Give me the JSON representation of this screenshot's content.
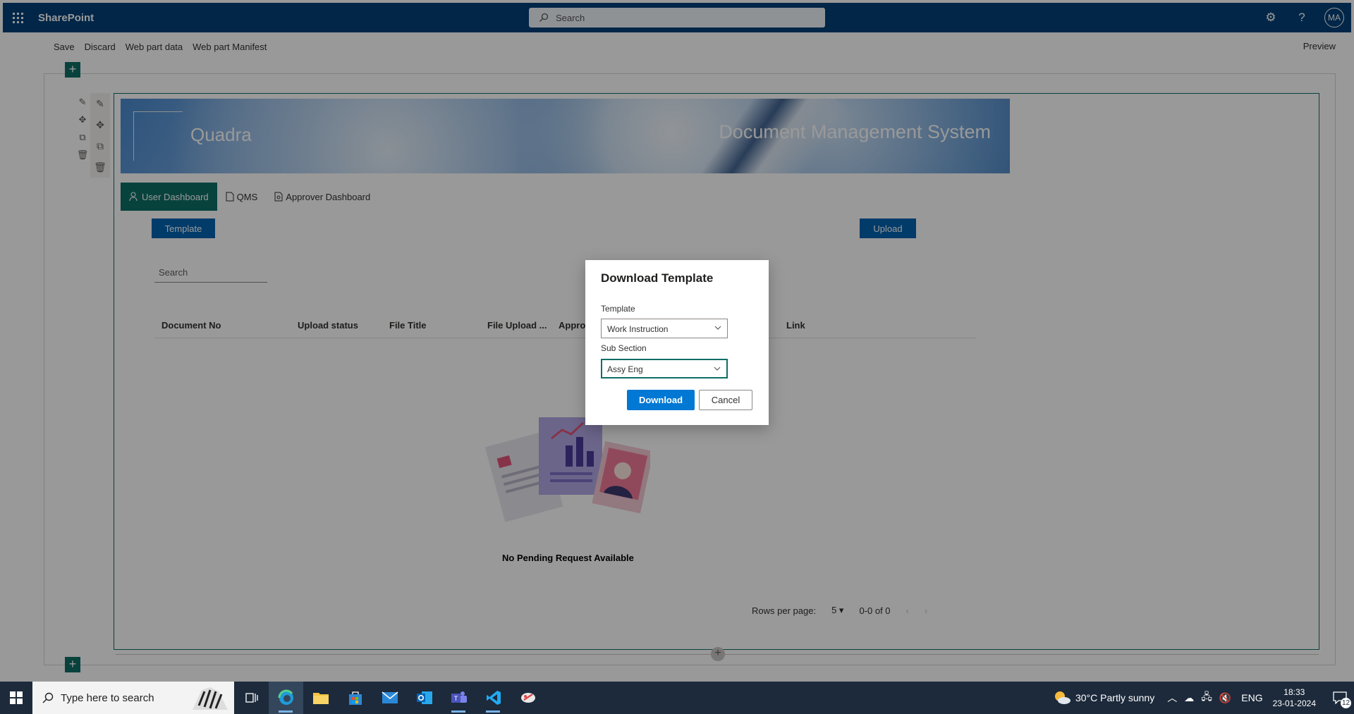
{
  "suite": {
    "app_name": "SharePoint",
    "search_placeholder": "Search",
    "avatar_initials": "MA"
  },
  "commands": {
    "save": "Save",
    "discard": "Discard",
    "web_part_data": "Web part data",
    "web_part_manifest": "Web part Manifest",
    "preview": "Preview"
  },
  "banner": {
    "company": "Quadra",
    "title": "Document Management System"
  },
  "tabs": [
    {
      "label": "User Dashboard",
      "active": true
    },
    {
      "label": "QMS",
      "active": false
    },
    {
      "label": "Approver Dashboard",
      "active": false
    }
  ],
  "actions": {
    "template": "Template",
    "upload": "Upload"
  },
  "grid": {
    "search_placeholder": "Search",
    "columns": [
      "Document No",
      "Upload status",
      "File Title",
      "File Upload ...",
      "Approv",
      "Link"
    ],
    "empty_message": "No Pending Request Available"
  },
  "pager": {
    "rows_label": "Rows per page:",
    "rows_value": "5",
    "range": "0-0 of 0"
  },
  "dialog": {
    "title": "Download Template",
    "template_label": "Template",
    "template_value": "Work Instruction",
    "subsection_label": "Sub Section",
    "subsection_value": "Assy Eng",
    "download": "Download",
    "cancel": "Cancel"
  },
  "taskbar": {
    "search_text": "Type here to search",
    "weather": "30°C  Partly sunny",
    "language": "ENG",
    "time": "18:33",
    "date": "23-01-2024",
    "notification_count": "12"
  },
  "colors": {
    "suite_bar": "#034078",
    "accent": "#0e6e66",
    "primary_button": "#0063b1",
    "dialog_button": "#0078d4"
  }
}
